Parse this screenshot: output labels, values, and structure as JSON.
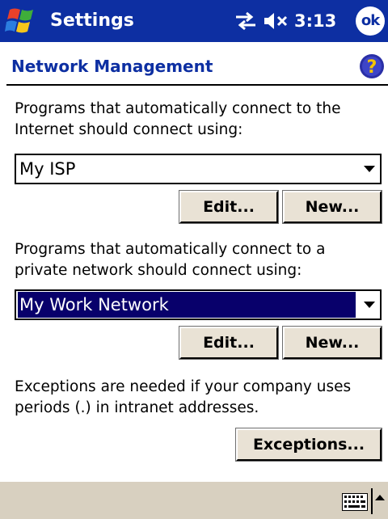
{
  "titlebar": {
    "app_title": "Settings",
    "clock": "3:13",
    "ok_label": "ok"
  },
  "header": {
    "title": "Network Management",
    "help_label": "?"
  },
  "internet": {
    "description": "Programs that automatically connect to the Internet should connect using:",
    "selected": "My ISP",
    "edit_label": "Edit...",
    "new_label": "New..."
  },
  "private": {
    "description": "Programs that automatically connect to a private network should connect using:",
    "selected": "My Work Network",
    "edit_label": "Edit...",
    "new_label": "New..."
  },
  "exceptions": {
    "description": "Exceptions are needed if your company uses periods (.) in intranet addresses.",
    "button_label": "Exceptions..."
  },
  "icons": {
    "start": "windows-flag-icon",
    "connectivity": "connectivity-arrows-icon",
    "volume": "speaker-muted-icon",
    "help": "help-icon",
    "keyboard": "keyboard-icon",
    "sip_arrow": "up-arrow-icon"
  },
  "colors": {
    "titlebar_bg": "#0d2fa2",
    "header_text": "#0d2fa2",
    "selection_bg": "#08006b",
    "button_face": "#e9e2d5",
    "bottombar_bg": "#d8d0c0"
  }
}
